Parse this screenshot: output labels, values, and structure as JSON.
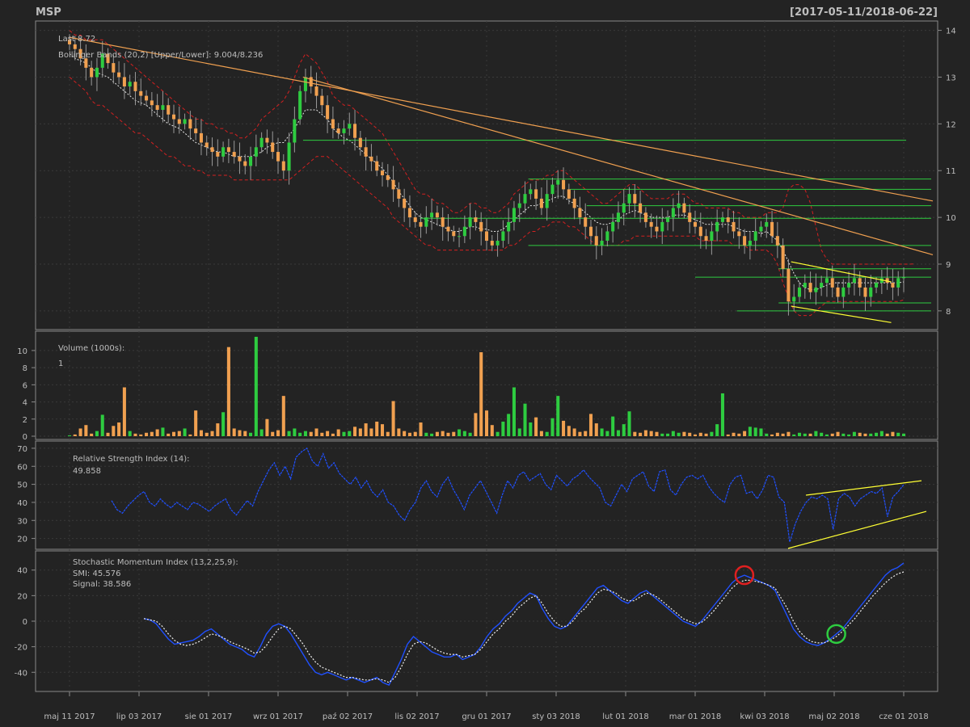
{
  "chart_data": {
    "type": "candlestick",
    "symbol": "MSP",
    "date_range": "[2017-05-11/2018-06-22]",
    "x_ticks": [
      "maj 11 2017",
      "lip 03 2017",
      "sie 01 2017",
      "wrz 01 2017",
      "paź 02 2017",
      "lis 02 2017",
      "gru 01 2017",
      "sty 03 2018",
      "lut 01 2018",
      "mar 01 2018",
      "kwi 03 2018",
      "maj 02 2018",
      "cze 01 2018"
    ],
    "price_panel": {
      "ylim": [
        7.6,
        14.2
      ],
      "y_ticks": [
        "8",
        "9",
        "10",
        "11",
        "12",
        "13",
        "14"
      ],
      "last_label": "Last 8.72",
      "bb_label": "Bollinger Bands (20,2) [Upper/Lower]: 9.004/8.236",
      "close": [
        13.7,
        13.6,
        13.4,
        13.2,
        13.0,
        13.2,
        13.5,
        13.3,
        13.1,
        13.0,
        12.8,
        12.9,
        12.7,
        12.6,
        12.5,
        12.4,
        12.3,
        12.4,
        12.2,
        12.1,
        12.0,
        12.1,
        11.9,
        11.8,
        11.6,
        11.5,
        11.4,
        11.3,
        11.5,
        11.4,
        11.3,
        11.2,
        11.1,
        11.3,
        11.5,
        11.7,
        11.6,
        11.4,
        11.2,
        11.0,
        11.6,
        12.1,
        12.7,
        13.0,
        12.8,
        12.6,
        12.4,
        12.1,
        11.9,
        11.8,
        11.9,
        12.0,
        11.7,
        11.5,
        11.3,
        11.2,
        11.0,
        10.9,
        10.8,
        10.6,
        10.4,
        10.2,
        10.0,
        9.9,
        9.8,
        10.0,
        10.1,
        10.0,
        9.8,
        9.7,
        9.6,
        9.6,
        9.8,
        10.0,
        9.9,
        9.7,
        9.5,
        9.4,
        9.5,
        9.7,
        9.9,
        10.2,
        10.3,
        10.5,
        10.6,
        10.4,
        10.2,
        10.5,
        10.7,
        10.8,
        10.6,
        10.4,
        10.2,
        10.0,
        9.8,
        9.6,
        9.4,
        9.5,
        9.7,
        9.9,
        10.1,
        10.3,
        10.5,
        10.3,
        10.1,
        9.9,
        9.8,
        9.7,
        9.9,
        10.0,
        10.2,
        10.3,
        10.1,
        9.9,
        9.8,
        9.6,
        9.5,
        9.7,
        9.9,
        10.0,
        9.9,
        9.7,
        9.6,
        9.4,
        9.5,
        9.7,
        9.8,
        9.9,
        9.6,
        9.4,
        8.9,
        8.2,
        8.3,
        8.5,
        8.6,
        8.4,
        8.5,
        8.6,
        8.7,
        8.5,
        8.3,
        8.5,
        8.6,
        8.7,
        8.5,
        8.3,
        8.5,
        8.6,
        8.7,
        8.6,
        8.5,
        8.7,
        8.72
      ],
      "bb_upper": [
        14.0,
        13.9,
        13.9,
        13.8,
        13.8,
        13.8,
        13.8,
        13.7,
        13.6,
        13.5,
        13.4,
        13.3,
        13.2,
        13.1,
        13.0,
        12.9,
        12.8,
        12.7,
        12.6,
        12.5,
        12.4,
        12.3,
        12.2,
        12.1,
        12.1,
        12.0,
        12.0,
        11.9,
        11.9,
        11.8,
        11.8,
        11.7,
        11.7,
        11.8,
        11.9,
        12.1,
        12.2,
        12.3,
        12.4,
        12.5,
        12.7,
        13.0,
        13.3,
        13.5,
        13.4,
        13.3,
        13.1,
        12.9,
        12.6,
        12.5,
        12.4,
        12.4,
        12.3,
        12.2,
        12.1,
        12.0,
        11.9,
        11.8,
        11.6,
        11.4,
        11.2,
        11.0,
        10.8,
        10.6,
        10.5,
        10.5,
        10.4,
        10.3,
        10.3,
        10.2,
        10.1,
        10.1,
        10.2,
        10.3,
        10.3,
        10.2,
        10.2,
        10.1,
        10.1,
        10.2,
        10.3,
        10.5,
        10.6,
        10.7,
        10.8,
        10.8,
        10.8,
        10.9,
        10.9,
        11.0,
        11.0,
        10.9,
        10.8,
        10.7,
        10.6,
        10.5,
        10.4,
        10.3,
        10.3,
        10.4,
        10.5,
        10.6,
        10.7,
        10.7,
        10.6,
        10.5,
        10.4,
        10.4,
        10.4,
        10.4,
        10.5,
        10.5,
        10.5,
        10.4,
        10.3,
        10.3,
        10.2,
        10.2,
        10.2,
        10.2,
        10.2,
        10.1,
        10.1,
        10.0,
        10.0,
        10.0,
        10.0,
        10.1,
        10.1,
        10.1,
        10.2,
        10.6,
        10.7,
        10.7,
        10.6,
        10.3,
        9.8,
        9.3,
        9.1,
        9.0,
        9.0,
        9.0,
        9.0,
        9.0,
        9.0,
        9.0,
        9.0,
        9.0,
        9.0,
        9.0,
        9.0,
        9.0,
        9.0,
        9.0,
        9.004
      ],
      "bb_lower": [
        13.0,
        12.9,
        12.8,
        12.7,
        12.5,
        12.4,
        12.4,
        12.3,
        12.2,
        12.1,
        12.0,
        11.9,
        11.8,
        11.8,
        11.7,
        11.6,
        11.5,
        11.4,
        11.3,
        11.3,
        11.2,
        11.1,
        11.1,
        11.0,
        11.0,
        10.9,
        10.9,
        10.9,
        10.9,
        10.9,
        10.8,
        10.8,
        10.8,
        10.8,
        10.8,
        10.8,
        10.8,
        10.8,
        10.8,
        10.8,
        10.8,
        10.9,
        11.0,
        11.1,
        11.2,
        11.3,
        11.3,
        11.3,
        11.2,
        11.1,
        11.0,
        10.9,
        10.8,
        10.7,
        10.6,
        10.5,
        10.4,
        10.3,
        10.2,
        10.0,
        9.9,
        9.8,
        9.7,
        9.6,
        9.5,
        9.4,
        9.4,
        9.3,
        9.3,
        9.3,
        9.3,
        9.3,
        9.3,
        9.3,
        9.3,
        9.3,
        9.3,
        9.3,
        9.3,
        9.3,
        9.4,
        9.4,
        9.5,
        9.6,
        9.7,
        9.7,
        9.8,
        9.8,
        9.9,
        9.9,
        9.9,
        9.8,
        9.8,
        9.7,
        9.6,
        9.5,
        9.4,
        9.4,
        9.4,
        9.4,
        9.4,
        9.5,
        9.5,
        9.6,
        9.6,
        9.6,
        9.6,
        9.6,
        9.6,
        9.6,
        9.6,
        9.6,
        9.6,
        9.6,
        9.6,
        9.5,
        9.5,
        9.5,
        9.5,
        9.5,
        9.5,
        9.4,
        9.4,
        9.4,
        9.3,
        9.3,
        9.3,
        9.3,
        9.2,
        9.0,
        8.6,
        8.3,
        8.0,
        7.9,
        7.9,
        7.9,
        8.0,
        8.1,
        8.2,
        8.2,
        8.2,
        8.2,
        8.2,
        8.2,
        8.2,
        8.2,
        8.2,
        8.2,
        8.2,
        8.2,
        8.2,
        8.2,
        8.236
      ],
      "ma": [
        13.5,
        13.4,
        13.35,
        13.3,
        13.2,
        13.1,
        13.05,
        13.0,
        12.9,
        12.8,
        12.7,
        12.6,
        12.5,
        12.45,
        12.4,
        12.3,
        12.2,
        12.1,
        12.0,
        11.95,
        11.9,
        11.8,
        11.7,
        11.6,
        11.55,
        11.5,
        11.45,
        11.4,
        11.4,
        11.35,
        11.3,
        11.3,
        11.3,
        11.3,
        11.35,
        11.4,
        11.5,
        11.55,
        11.6,
        11.6,
        11.75,
        11.9,
        12.1,
        12.3,
        12.3,
        12.3,
        12.2,
        12.1,
        11.9,
        11.8,
        11.7,
        11.65,
        11.55,
        11.45,
        11.35,
        11.25,
        11.15,
        11.05,
        10.9,
        10.75,
        10.55,
        10.4,
        10.25,
        10.1,
        10.0,
        9.95,
        9.9,
        9.85,
        9.8,
        9.75,
        9.7,
        9.7,
        9.75,
        9.8,
        9.8,
        9.75,
        9.75,
        9.7,
        9.7,
        9.75,
        9.85,
        9.95,
        10.05,
        10.15,
        10.25,
        10.25,
        10.3,
        10.35,
        10.4,
        10.45,
        10.45,
        10.35,
        10.3,
        10.2,
        10.1,
        10.0,
        9.9,
        9.85,
        9.85,
        9.9,
        9.95,
        10.05,
        10.1,
        10.15,
        10.1,
        10.05,
        10.0,
        10.0,
        10.0,
        10.0,
        10.05,
        10.05,
        10.05,
        10.0,
        9.95,
        9.9,
        9.85,
        9.85,
        9.85,
        9.85,
        9.85,
        9.8,
        9.75,
        9.7,
        9.7,
        9.7,
        9.65,
        9.7,
        9.6,
        9.5,
        9.3,
        9.05,
        8.8,
        8.6,
        8.5,
        8.45,
        8.45,
        8.5,
        8.55,
        8.6,
        8.6,
        8.6,
        8.6,
        8.6,
        8.6,
        8.6,
        8.6,
        8.6,
        8.6,
        8.6,
        8.6,
        8.6,
        8.62
      ]
    },
    "volume_panel": {
      "label": "Volume (1000s):",
      "last": "1",
      "ylim": [
        0,
        11.5
      ],
      "y_ticks": [
        "0",
        "2",
        "4",
        "6",
        "8",
        "10"
      ],
      "values": [
        0.1,
        0.2,
        0.9,
        1.3,
        0.3,
        0.6,
        2.5,
        0.4,
        1.2,
        1.6,
        5.7,
        0.6,
        0.3,
        0.2,
        0.4,
        0.5,
        0.8,
        1.0,
        0.3,
        0.5,
        0.6,
        0.9,
        0.2,
        3.0,
        0.7,
        0.4,
        0.6,
        1.5,
        2.8,
        10.4,
        0.9,
        0.7,
        0.6,
        0.4,
        11.6,
        0.8,
        2.0,
        0.5,
        0.7,
        4.7,
        0.6,
        0.9,
        0.4,
        0.6,
        0.5,
        0.9,
        0.4,
        0.6,
        0.3,
        0.8,
        0.5,
        0.6,
        1.1,
        0.9,
        1.5,
        0.9,
        1.7,
        1.4,
        0.5,
        4.1,
        0.9,
        0.6,
        0.4,
        0.5,
        1.6,
        0.4,
        0.3,
        0.5,
        0.6,
        0.4,
        0.5,
        0.8,
        0.6,
        0.4,
        2.7,
        9.8,
        3.0,
        1.3,
        0.5,
        1.7,
        2.6,
        5.7,
        0.9,
        3.8,
        1.6,
        2.2,
        0.6,
        0.5,
        2.1,
        4.7,
        1.8,
        1.2,
        0.9,
        0.5,
        0.6,
        2.6,
        1.5,
        0.9,
        0.6,
        2.3,
        0.7,
        1.4,
        2.9,
        0.5,
        0.4,
        0.7,
        0.6,
        0.5,
        0.3,
        0.3,
        0.6,
        0.4,
        0.5,
        0.4,
        0.2,
        0.4,
        0.3,
        0.5,
        1.4,
        5.0,
        0.2,
        0.4,
        0.3,
        0.6,
        1.1,
        1.0,
        0.9,
        0.3,
        0.2,
        0.4,
        0.3,
        0.5,
        0.2,
        0.4,
        0.3,
        0.3,
        0.6,
        0.4,
        0.2,
        0.3,
        0.5,
        0.3,
        0.2,
        0.5,
        0.4,
        0.3,
        0.3,
        0.4,
        0.6,
        0.3,
        0.5,
        0.4,
        0.3
      ]
    },
    "rsi_panel": {
      "label": "Relative Strength Index (14):",
      "last": "49.858",
      "ylim": [
        14,
        74
      ],
      "y_ticks": [
        "20",
        "30",
        "40",
        "50",
        "60",
        "70"
      ],
      "values": [
        41,
        36,
        34,
        38,
        41,
        44,
        46,
        40,
        38,
        42,
        39,
        37,
        40,
        38,
        36,
        40,
        39,
        37,
        35,
        38,
        40,
        42,
        36,
        33,
        37,
        41,
        38,
        46,
        52,
        58,
        62,
        55,
        60,
        53,
        65,
        68,
        70,
        63,
        60,
        67,
        59,
        62,
        56,
        53,
        50,
        54,
        48,
        52,
        46,
        43,
        47,
        40,
        38,
        33,
        30,
        36,
        40,
        48,
        52,
        46,
        43,
        50,
        54,
        47,
        42,
        36,
        44,
        48,
        52,
        46,
        40,
        34,
        44,
        52,
        48,
        55,
        57,
        52,
        54,
        56,
        50,
        47,
        55,
        52,
        49,
        53,
        55,
        58,
        54,
        51,
        48,
        40,
        38,
        44,
        50,
        46,
        53,
        55,
        57,
        49,
        46,
        57,
        58,
        47,
        44,
        50,
        54,
        55,
        53,
        55,
        49,
        45,
        42,
        40,
        50,
        54,
        55,
        45,
        46,
        42,
        47,
        55,
        54,
        43,
        40,
        18,
        28,
        35,
        40,
        43,
        42,
        44,
        42,
        25,
        42,
        45,
        43,
        38,
        42,
        44,
        46,
        45,
        48,
        32,
        43,
        46,
        49.858
      ],
      "trendlines": [
        {
          "from": [
            0,
            14.5
          ],
          "to": [
            1,
            35
          ]
        },
        {
          "from": [
            0,
            44
          ],
          "to": [
            1,
            52
          ]
        }
      ]
    },
    "smi_panel": {
      "label": "Stochastic Momentum Index (13,2,25,9):",
      "smi_label": "SMI: 45.576",
      "signal_label": "Signal: 38.586",
      "ylim": [
        -55,
        55
      ],
      "y_ticks": [
        "-40",
        "-20",
        "0",
        "20",
        "40"
      ],
      "smi": [
        2,
        1,
        -2,
        -8,
        -14,
        -18,
        -17,
        -16,
        -15,
        -12,
        -8,
        -6,
        -10,
        -14,
        -18,
        -20,
        -22,
        -26,
        -28,
        -20,
        -10,
        -4,
        -2,
        -4,
        -10,
        -18,
        -26,
        -34,
        -40,
        -42,
        -40,
        -42,
        -44,
        -46,
        -44,
        -46,
        -48,
        -46,
        -44,
        -48,
        -50,
        -40,
        -30,
        -18,
        -12,
        -16,
        -20,
        -24,
        -26,
        -28,
        -28,
        -26,
        -30,
        -28,
        -26,
        -20,
        -12,
        -6,
        -2,
        4,
        8,
        14,
        18,
        22,
        20,
        10,
        2,
        -4,
        -6,
        -4,
        2,
        8,
        14,
        20,
        26,
        28,
        24,
        20,
        16,
        14,
        18,
        22,
        24,
        20,
        16,
        12,
        8,
        4,
        0,
        -2,
        -4,
        0,
        6,
        12,
        18,
        24,
        30,
        34,
        36,
        34,
        32,
        30,
        28,
        24,
        14,
        4,
        -6,
        -12,
        -16,
        -18,
        -19,
        -17,
        -14,
        -10,
        -6,
        0,
        6,
        12,
        18,
        24,
        30,
        36,
        40,
        42,
        45.576
      ],
      "signal": [
        2,
        1,
        0,
        -4,
        -10,
        -15,
        -18,
        -19,
        -18,
        -16,
        -13,
        -10,
        -11,
        -13,
        -16,
        -18,
        -20,
        -22,
        -25,
        -24,
        -19,
        -12,
        -6,
        -4,
        -6,
        -12,
        -18,
        -26,
        -32,
        -36,
        -38,
        -40,
        -42,
        -44,
        -44,
        -45,
        -46,
        -46,
        -45,
        -46,
        -48,
        -44,
        -36,
        -26,
        -18,
        -16,
        -17,
        -20,
        -23,
        -25,
        -26,
        -26,
        -28,
        -27,
        -26,
        -22,
        -16,
        -10,
        -6,
        0,
        4,
        10,
        14,
        18,
        20,
        14,
        6,
        0,
        -4,
        -4,
        0,
        6,
        10,
        16,
        22,
        25,
        24,
        22,
        18,
        16,
        16,
        19,
        22,
        21,
        18,
        14,
        10,
        6,
        2,
        0,
        -2,
        -1,
        3,
        8,
        14,
        20,
        26,
        30,
        32,
        32,
        31,
        30,
        28,
        26,
        18,
        10,
        0,
        -8,
        -13,
        -16,
        -17,
        -17,
        -15,
        -12,
        -8,
        -3,
        2,
        8,
        14,
        20,
        25,
        30,
        34,
        37,
        38.586
      ],
      "markers": [
        {
          "type": "circle",
          "color": "#e02020",
          "at_index": 98
        },
        {
          "type": "circle",
          "color": "#2ecc40",
          "at_index": 113
        }
      ]
    },
    "trendlines_price": [
      {
        "color": "#f0a050",
        "from": [
          0,
          13.85
        ],
        "to": [
          1,
          10.35
        ]
      },
      {
        "color": "#f0a050",
        "from": [
          0.28,
          13.0
        ],
        "to": [
          1,
          9.2
        ]
      },
      {
        "color": "#ffff33",
        "from": [
          0.865,
          9.05
        ],
        "to": [
          0.985,
          8.62
        ]
      },
      {
        "color": "#ffff33",
        "from": [
          0.865,
          8.1
        ],
        "to": [
          0.985,
          7.75
        ]
      }
    ],
    "support_levels": [
      {
        "y": 11.65,
        "from": 0.28,
        "to": 0.97
      },
      {
        "y": 10.82,
        "from": 0.55,
        "to": 1.0
      },
      {
        "y": 10.6,
        "from": 0.6,
        "to": 1.0
      },
      {
        "y": 10.25,
        "from": 0.62,
        "to": 1.0
      },
      {
        "y": 9.98,
        "from": 0.42,
        "to": 1.0
      },
      {
        "y": 9.4,
        "from": 0.55,
        "to": 1.0
      },
      {
        "y": 8.9,
        "from": 0.85,
        "to": 1.0
      },
      {
        "y": 8.72,
        "from": 0.75,
        "to": 1.0
      },
      {
        "y": 8.17,
        "from": 0.85,
        "to": 1.0
      },
      {
        "y": 8.0,
        "from": 0.8,
        "to": 1.0
      }
    ],
    "colors": {
      "background": "#232323",
      "panel_border": "#8a8a8a",
      "grid": "#3a3a3a",
      "up": "#2ecc40",
      "down": "#f0a050",
      "bb": "#d42020",
      "ma": "#e8e8e8",
      "rsi": "#2050ff",
      "smi": "#2050ff",
      "signal": "#f0f0f0",
      "support": "#2ecc40",
      "last_text": "#f0a050",
      "bb_text": "#d42020",
      "label_text": "#9a9a9a"
    }
  }
}
